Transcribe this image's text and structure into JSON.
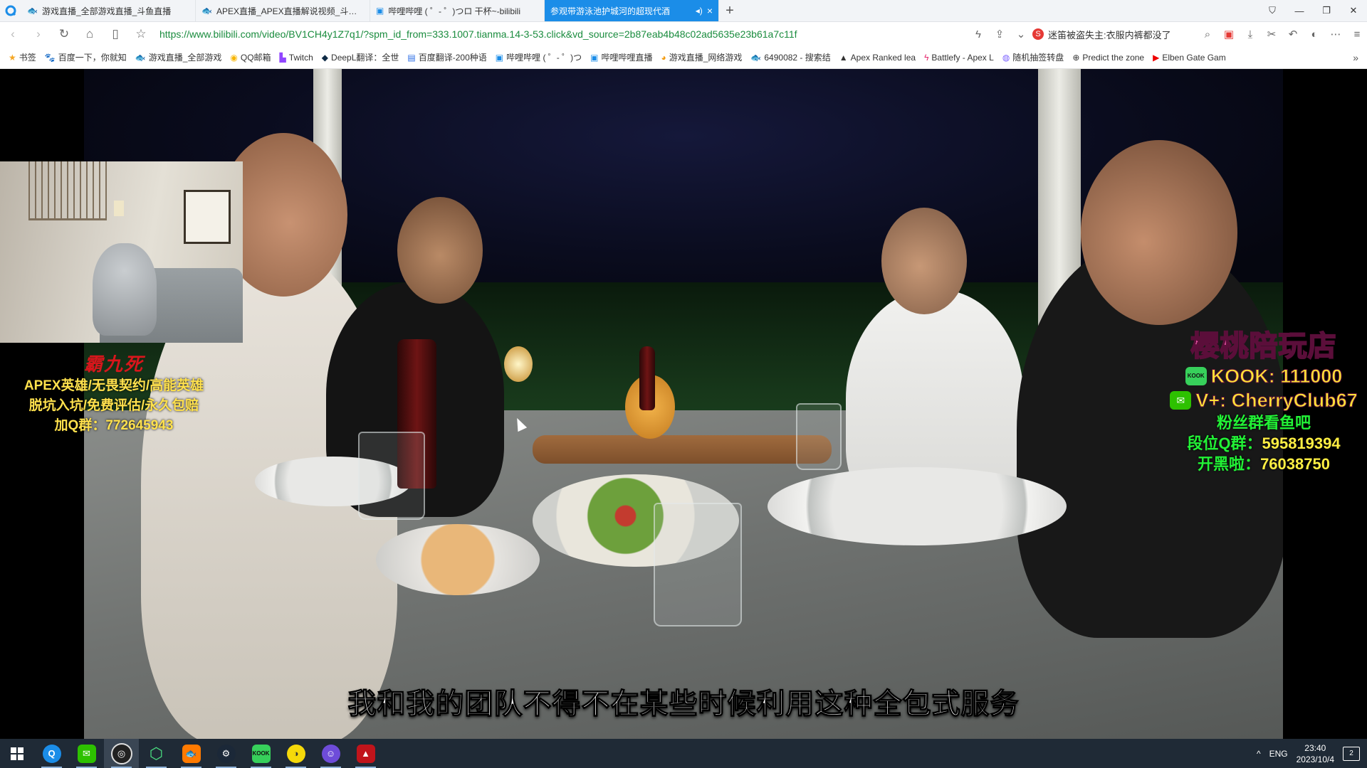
{
  "tabs": [
    {
      "title": "游戏直播_全部游戏直播_斗鱼直播",
      "icon": "douyu-icon"
    },
    {
      "title": "APEX直播_APEX直播解说视频_斗鱼直",
      "icon": "douyu-icon"
    },
    {
      "title": "哔哩哔哩 ( ゜- ゜)つロ 干杯~-bilibili",
      "icon": "bilibili-icon"
    },
    {
      "title": "参观带游泳池护城河的超现代酒",
      "icon": "bilibili-icon",
      "active": true
    }
  ],
  "address": {
    "url": "https://www.bilibili.com/video/BV1CH4y1Z7q1/?spm_id_from=333.1007.tianma.14-3-53.click&vd_source=2b87eab4b48c02ad5635e23b61a7c11f",
    "hot_search": "迷笛被盗失主:衣服内裤都没了"
  },
  "bookmarks": [
    "书签",
    "百度一下，你就知",
    "游戏直播_全部游戏",
    "QQ邮箱",
    "Twitch",
    "DeepL翻译：全世",
    "百度翻译-200种语",
    "哔哩哔哩 ( ゜- ゜)つ",
    "哔哩哔哩直播",
    "游戏直播_网络游戏",
    "6490082 - 搜索结",
    "Apex Ranked lea",
    "Battlefy - Apex L",
    "随机抽签转盘",
    "Predict the zone",
    "Elben Gate Gam"
  ],
  "overlay_left": {
    "name": "霸九死",
    "lines": [
      "APEX英雄/无畏契约/高能英雄",
      "脱坑入坑/免费评估/永久包赔",
      "加Q群：772645943"
    ]
  },
  "overlay_right": {
    "shop": "樱桃陪玩店",
    "kook": "KOOK: 111000",
    "wechat": "V+: CherryClub67",
    "fans": "粉丝群看鱼吧",
    "rank_label": "段位Q群：",
    "rank_num": "595819394",
    "open_label": "开黑啦：",
    "open_num": "76038750"
  },
  "subtitle": "我和我的团队不得不在某些时候利用这种全包式服务",
  "taskbar": {
    "apps": [
      "browser",
      "wechat",
      "obs",
      "green-app",
      "douyu",
      "steam",
      "kook",
      "yellow-app",
      "discord-like",
      "apex"
    ],
    "lang": "ENG",
    "time": "23:40",
    "date": "2023/10/4",
    "notifications": "2"
  }
}
